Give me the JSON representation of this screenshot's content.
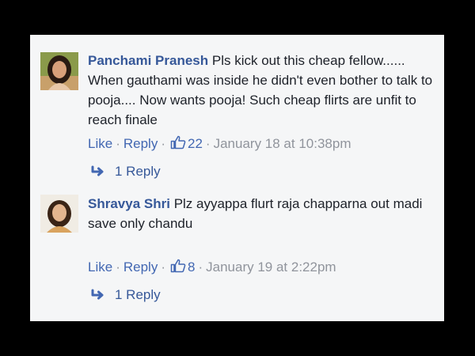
{
  "comments": [
    {
      "author": "Panchami Pranesh",
      "text": "Pls kick out this cheap fellow...... When gauthami was inside he didn't even bother to talk to pooja.... Now wants pooja! Such cheap flirts are unfit to reach finale",
      "like_label": "Like",
      "reply_label": "Reply",
      "like_count": "22",
      "timestamp": "January 18 at 10:38pm",
      "replies_label": "1 Reply"
    },
    {
      "author": "Shravya Shri",
      "text_line1": "Plz ayyappa flurt raja chapparna out madi",
      "text_line2": "save only chandu",
      "like_label": "Like",
      "reply_label": "Reply",
      "like_count": "8",
      "timestamp": "January 19 at 2:22pm",
      "replies_label": "1 Reply"
    }
  ],
  "colors": {
    "link": "#4267b2",
    "author": "#365899",
    "meta": "#90949c",
    "panel": "#f5f6f7",
    "frame": "#000000"
  },
  "icons": {
    "like": "thumbs-up-icon",
    "reply": "reply-arrow-icon"
  }
}
